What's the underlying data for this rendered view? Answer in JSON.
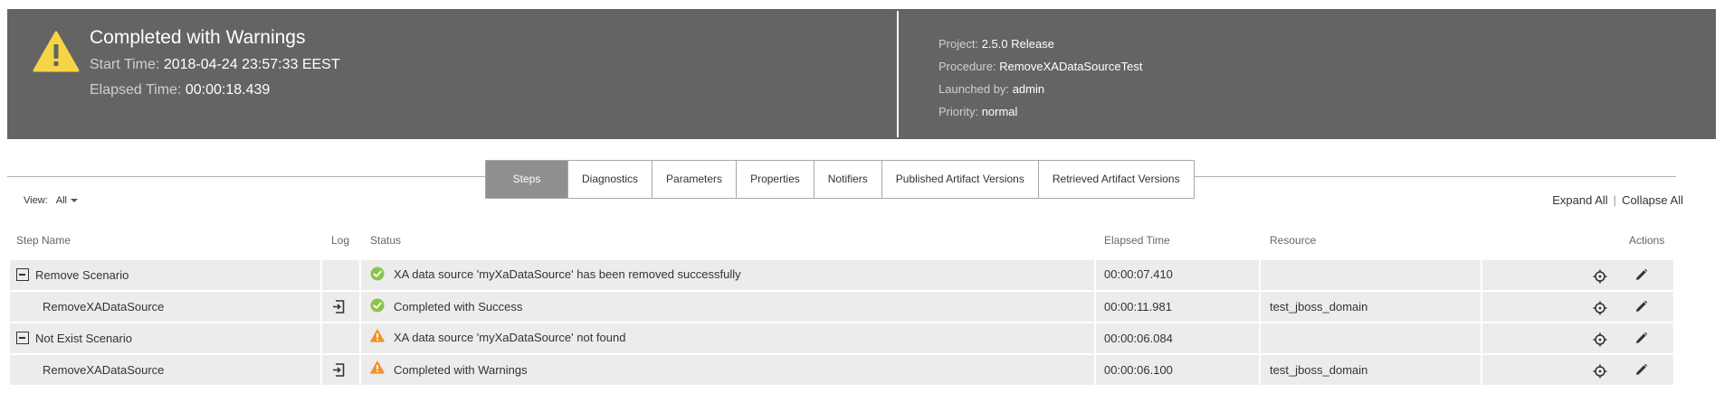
{
  "header": {
    "title": "Completed with Warnings",
    "start_label": "Start Time:",
    "start_value": "2018-04-24 23:57:33 EEST",
    "elapsed_label": "Elapsed Time:",
    "elapsed_value": "00:00:18.439",
    "project_label": "Project:",
    "project_value": "2.5.0 Release",
    "procedure_label": "Procedure:",
    "procedure_value": "RemoveXADataSourceTest",
    "launched_label": "Launched by:",
    "launched_value": "admin",
    "priority_label": "Priority:",
    "priority_value": "normal"
  },
  "tabs": [
    {
      "label": "Steps",
      "active": true
    },
    {
      "label": "Diagnostics"
    },
    {
      "label": "Parameters"
    },
    {
      "label": "Properties"
    },
    {
      "label": "Notifiers"
    },
    {
      "label": "Published Artifact Versions"
    },
    {
      "label": "Retrieved Artifact Versions"
    }
  ],
  "view": {
    "label": "View:",
    "value": "All"
  },
  "expand_all": "Expand All",
  "collapse_all": "Collapse All",
  "columns": {
    "step_name": "Step Name",
    "log": "Log",
    "status": "Status",
    "elapsed": "Elapsed Time",
    "resource": "Resource",
    "actions": "Actions"
  },
  "rows": [
    {
      "name": "Remove Scenario",
      "status": "XA data source 'myXaDataSource' has been removed successfully",
      "elapsed": "00:00:07.410",
      "resource": ""
    },
    {
      "name": "RemoveXADataSource",
      "status": "Completed with Success",
      "elapsed": "00:00:11.981",
      "resource": "test_jboss_domain"
    },
    {
      "name": "Not Exist Scenario",
      "status": "XA data source 'myXaDataSource' not found",
      "elapsed": "00:00:06.084",
      "resource": ""
    },
    {
      "name": "RemoveXADataSource",
      "status": "Completed with Warnings",
      "elapsed": "00:00:06.100",
      "resource": "test_jboss_domain"
    }
  ],
  "colors": {
    "header_bg": "#646464",
    "success": "#8bc34a",
    "warning": "#f0932b",
    "warning_big": "#f5d547"
  }
}
